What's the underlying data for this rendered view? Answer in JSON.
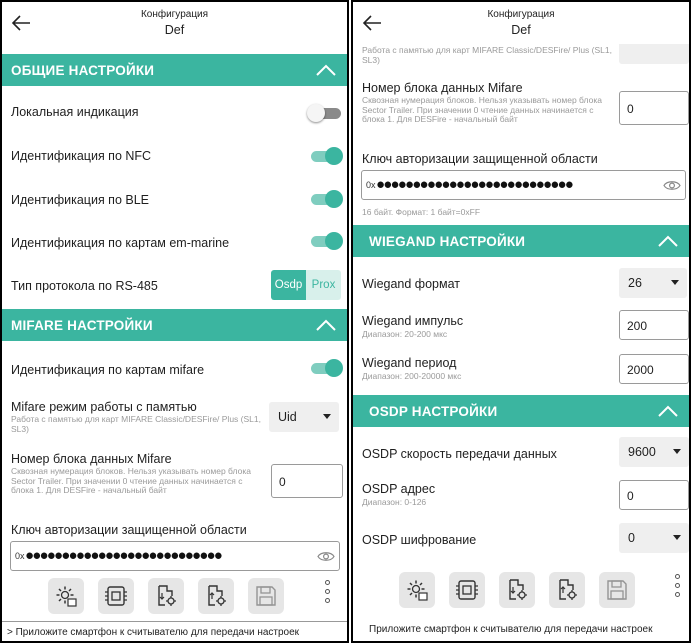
{
  "colors": {
    "accent": "#3bb5a0",
    "accent_light": "#7fcdbf",
    "segment_unselected_bg": "#d8f0eb",
    "select_bg": "#efefef",
    "toolbar_button_bg": "#e6e6e6"
  },
  "icons": [
    "arrow-left-icon",
    "chevron-up-icon",
    "eye-icon",
    "gear-settings-icon",
    "chip-icon",
    "file-settings-icon",
    "file-export-icon",
    "floppy-save-icon",
    "more-vertical-icon"
  ],
  "left": {
    "header": {
      "title": "Конфигурация",
      "subtitle": "Def"
    },
    "general": {
      "title": "ОБЩИЕ НАСТРОЙКИ",
      "local_indication": {
        "label": "Локальная индикация",
        "enabled": false
      },
      "nfc": {
        "label": "Идентификация по NFC",
        "enabled": true
      },
      "ble": {
        "label": "Идентификация по BLE",
        "enabled": true
      },
      "em_marine": {
        "label": "Идентификация по картам em-marine",
        "enabled": true
      },
      "rs485": {
        "label": "Тип протокола по RS-485",
        "options": [
          "Osdp",
          "Prox"
        ],
        "selected": "Osdp"
      }
    },
    "mifare": {
      "title": "MIFARE НАСТРОЙКИ",
      "mifare_cards": {
        "label": "Идентификация по картам mifare",
        "enabled": true
      },
      "memory_mode": {
        "label": "Mifare режим работы с памятью",
        "hint": "Работа с памятью для карт MIFARE Classic/DESFire/ Plus (SL1, SL3)",
        "value": "Uid"
      },
      "block_number": {
        "label": "Номер блока данных Mifare",
        "hint": "Сквозная нумерация блоков. Нельзя указывать номер блока Sector Trailer. При значении 0 чтение данных начинается с блока 1. Для DESFire - начальный байт",
        "value": "0"
      },
      "auth_key": {
        "label": "Ключ авторизации защищенной области",
        "prefix": "0x",
        "dots": "●●●●●●●●●●●●●●●●●●●●●●●●●●●"
      }
    },
    "status": "> Приложите смартфон к считывателю для передачи настроек"
  },
  "right": {
    "header": {
      "title": "Конфигурация",
      "subtitle": "Def"
    },
    "mifare_memory_hint": "Работа с памятью для карт MIFARE Classic/DESFire/ Plus (SL1, SL3)",
    "block_number": {
      "label": "Номер блока данных Mifare",
      "hint": "Сквозная нумерация блоков. Нельзя указывать номер блока Sector Trailer. При значении 0 чтение данных начинается с блока 1. Для DESFire - начальный байт",
      "value": "0"
    },
    "auth_key": {
      "label": "Ключ авторизации защищенной области",
      "prefix": "0x",
      "dots": "●●●●●●●●●●●●●●●●●●●●●●●●●●●",
      "hint": "16 байт. Формат: 1 байт=0xFF"
    },
    "wiegand": {
      "title": "WIEGAND НАСТРОЙКИ",
      "format": {
        "label": "Wiegand формат",
        "value": "26"
      },
      "pulse": {
        "label": "Wiegand импульс",
        "hint": "Диапазон: 20-200 мкс",
        "value": "200"
      },
      "period": {
        "label": "Wiegand период",
        "hint": "Диапазон: 200-20000 мкс",
        "value": "2000"
      }
    },
    "osdp": {
      "title": "OSDP НАСТРОЙКИ",
      "speed": {
        "label": "OSDP скорость передачи данных",
        "value": "9600"
      },
      "address": {
        "label": "OSDP адрес",
        "hint": "Диапазон: 0-126",
        "value": "0"
      },
      "encryption": {
        "label": "OSDP шифрование",
        "value": "0"
      }
    },
    "status": "Приложите смартфон к считывателю для передачи настроек"
  }
}
